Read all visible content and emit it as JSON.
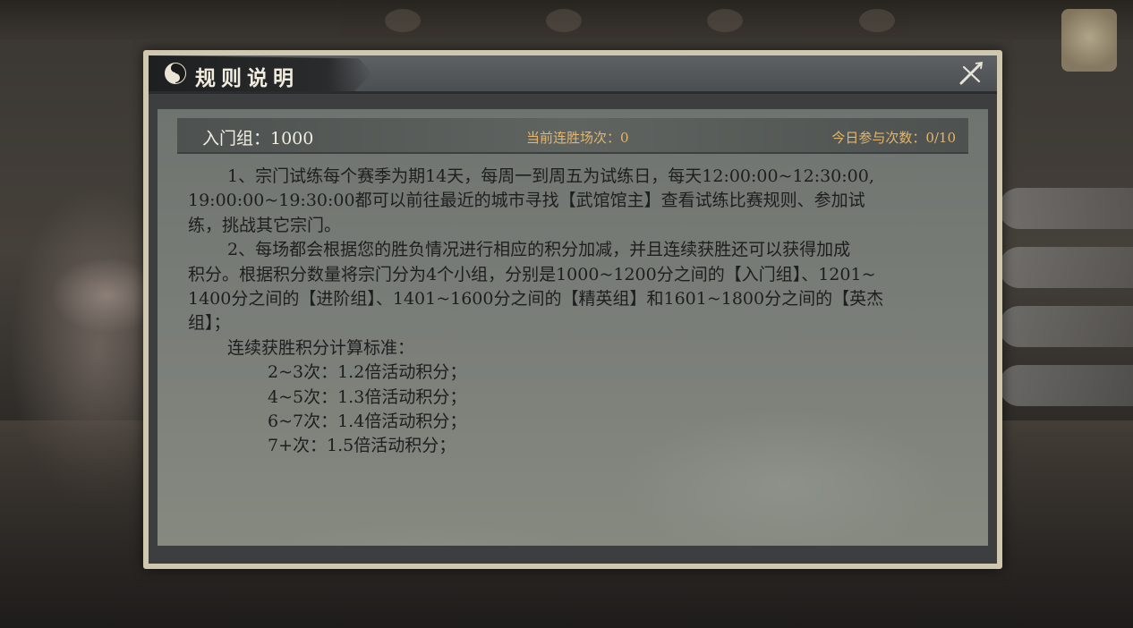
{
  "dialog": {
    "title": "规则说明",
    "close_icon": "close-sword-icon",
    "header_icon": "yinyang-icon"
  },
  "stats": {
    "group": "入门组：1000",
    "streak": "当前连胜场次：0",
    "attempts": "今日参与次数：0/10"
  },
  "rules": {
    "p1_line1": "1、宗门试练每个赛季为期14天，每周一到周五为试练日，每天12:00:00~12:30:00,",
    "p1_line2": "19:00:00~19:30:00都可以前往最近的城市寻找【武馆馆主】查看试练比赛规则、参加试",
    "p1_line3": "练，挑战其它宗门。",
    "p2_line1": "2、每场都会根据您的胜负情况进行相应的积分加减，并且连续获胜还可以获得加成",
    "p2_line2": "积分。根据积分数量将宗门分为4个小组，分别是1000~1200分之间的【入门组】、1201~",
    "p2_line3": "1400分之间的【进阶组】、1401~1600分之间的【精英组】和1601~1800分之间的【英杰",
    "p2_line4": "组】；",
    "bonus_heading": "连续获胜积分计算标准：",
    "bonus_items": [
      "2~3次：1.2倍活动积分；",
      "4~5次：1.3倍活动积分；",
      "6~7次：1.4倍活动积分；",
      "7+次：1.5倍活动积分；"
    ]
  },
  "colors": {
    "frame": "#cfc7ae",
    "panel": "#7a7e78",
    "accent_orange": "#e4b56a",
    "text_dark": "#1d1e1e",
    "title_text": "#f1ece0"
  }
}
